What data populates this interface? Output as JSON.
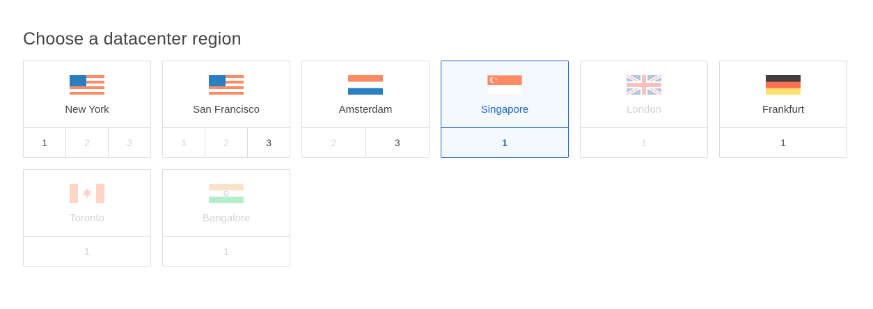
{
  "heading": "Choose a datacenter region",
  "colors": {
    "accent": "#1e64c8",
    "border": "#dcdcdc",
    "disabled_text": "#d4d4d4"
  },
  "regions": [
    {
      "name": "New York",
      "flag": "us-flag-icon",
      "state": "normal",
      "numbers": [
        {
          "label": "1",
          "state": "on"
        },
        {
          "label": "2",
          "state": "off"
        },
        {
          "label": "3",
          "state": "off"
        }
      ]
    },
    {
      "name": "San Francisco",
      "flag": "us-flag-icon",
      "state": "normal",
      "numbers": [
        {
          "label": "1",
          "state": "off"
        },
        {
          "label": "2",
          "state": "off"
        },
        {
          "label": "3",
          "state": "on"
        }
      ]
    },
    {
      "name": "Amsterdam",
      "flag": "netherlands-flag-icon",
      "state": "normal",
      "numbers": [
        {
          "label": "2",
          "state": "off"
        },
        {
          "label": "3",
          "state": "on"
        }
      ]
    },
    {
      "name": "Singapore",
      "flag": "singapore-flag-icon",
      "state": "selected",
      "numbers": [
        {
          "label": "1",
          "state": "selected"
        }
      ]
    },
    {
      "name": "London",
      "flag": "uk-flag-icon",
      "state": "disabled",
      "numbers": [
        {
          "label": "1",
          "state": "off"
        }
      ]
    },
    {
      "name": "Frankfurt",
      "flag": "germany-flag-icon",
      "state": "normal",
      "numbers": [
        {
          "label": "1",
          "state": "on"
        }
      ]
    },
    {
      "name": "Toronto",
      "flag": "canada-flag-icon",
      "state": "disabled",
      "numbers": [
        {
          "label": "1",
          "state": "off"
        }
      ]
    },
    {
      "name": "Bangalore",
      "flag": "india-flag-icon",
      "state": "disabled",
      "numbers": [
        {
          "label": "1",
          "state": "off"
        }
      ]
    }
  ]
}
